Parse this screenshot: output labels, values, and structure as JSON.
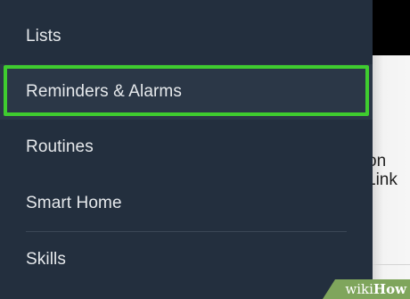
{
  "background_app": {
    "partial_text_1": "on",
    "partial_text_2": "Link"
  },
  "drawer": {
    "items": [
      {
        "label": "Lists"
      },
      {
        "label": "Reminders & Alarms",
        "highlighted": true
      },
      {
        "label": "Routines"
      },
      {
        "label": "Smart Home"
      },
      {
        "label": "Skills"
      }
    ]
  },
  "watermark": {
    "part1": "wiki",
    "part2": "How"
  },
  "colors": {
    "drawer_bg": "#232f3e",
    "highlight": "#3fcc2f",
    "watermark_bg": "#7fa55c"
  }
}
